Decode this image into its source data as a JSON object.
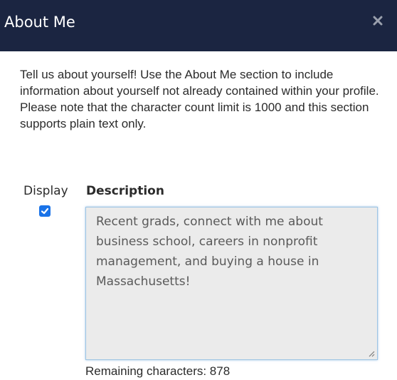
{
  "dialog": {
    "title": "About Me",
    "close_icon": "close-icon"
  },
  "intro": {
    "text": "Tell us about yourself! Use the About Me section to include information about yourself not already contained within your profile. Please note that the character count limit is 1000 and this section supports plain text only."
  },
  "form": {
    "display_label": "Display",
    "display_checked": true,
    "description_label": "Description",
    "description_value": "Recent grads, connect with me about business school, careers in nonprofit management, and buying a house in Massachusetts!",
    "remaining_text": "Remaining characters: 878"
  },
  "colors": {
    "titlebar": "#1b2541",
    "checkbox": "#1a73e8",
    "textarea_bg": "#ebebeb"
  }
}
